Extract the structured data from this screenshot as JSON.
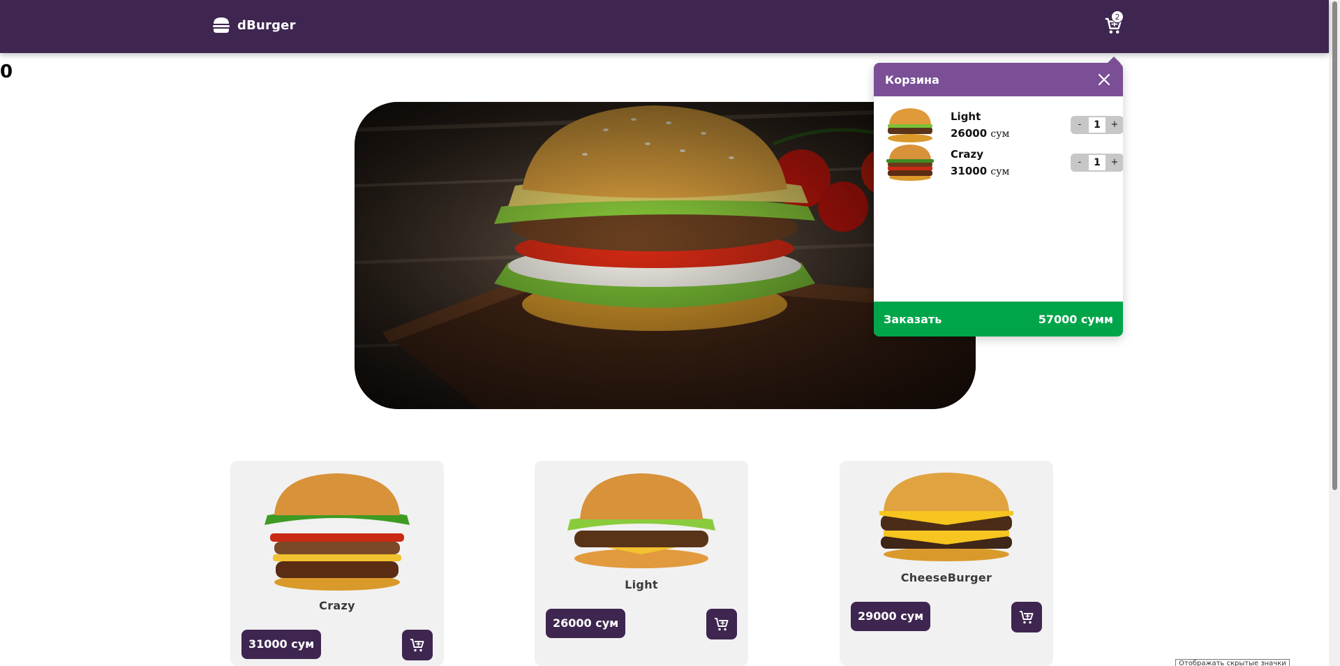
{
  "header": {
    "logo_text": "dBurger",
    "cart_count": "2"
  },
  "counter": "0",
  "cart": {
    "title": "Корзина",
    "items": [
      {
        "name": "Light",
        "price": "26000",
        "currency": "сум",
        "qty": "1",
        "minus": "-",
        "plus": "+"
      },
      {
        "name": "Crazy",
        "price": "31000",
        "currency": "сум",
        "qty": "1",
        "minus": "-",
        "plus": "+"
      }
    ],
    "order_label": "Заказать",
    "total": "57000 сумм"
  },
  "products": [
    {
      "name": "Crazy",
      "price": "31000 сум"
    },
    {
      "name": "Light",
      "price": "26000 сум"
    },
    {
      "name": "CheeseBurger",
      "price": "29000 сум"
    }
  ],
  "tooltip": "Отображать скрытые значки",
  "colors": {
    "header_bg": "#3e2650",
    "cart_header_bg": "#7a4f96",
    "order_bg": "#00a54a",
    "card_bg": "#f1f1f1"
  },
  "icons": [
    "burger-logo-icon",
    "cart-icon",
    "close-icon",
    "add-to-cart-icon"
  ]
}
